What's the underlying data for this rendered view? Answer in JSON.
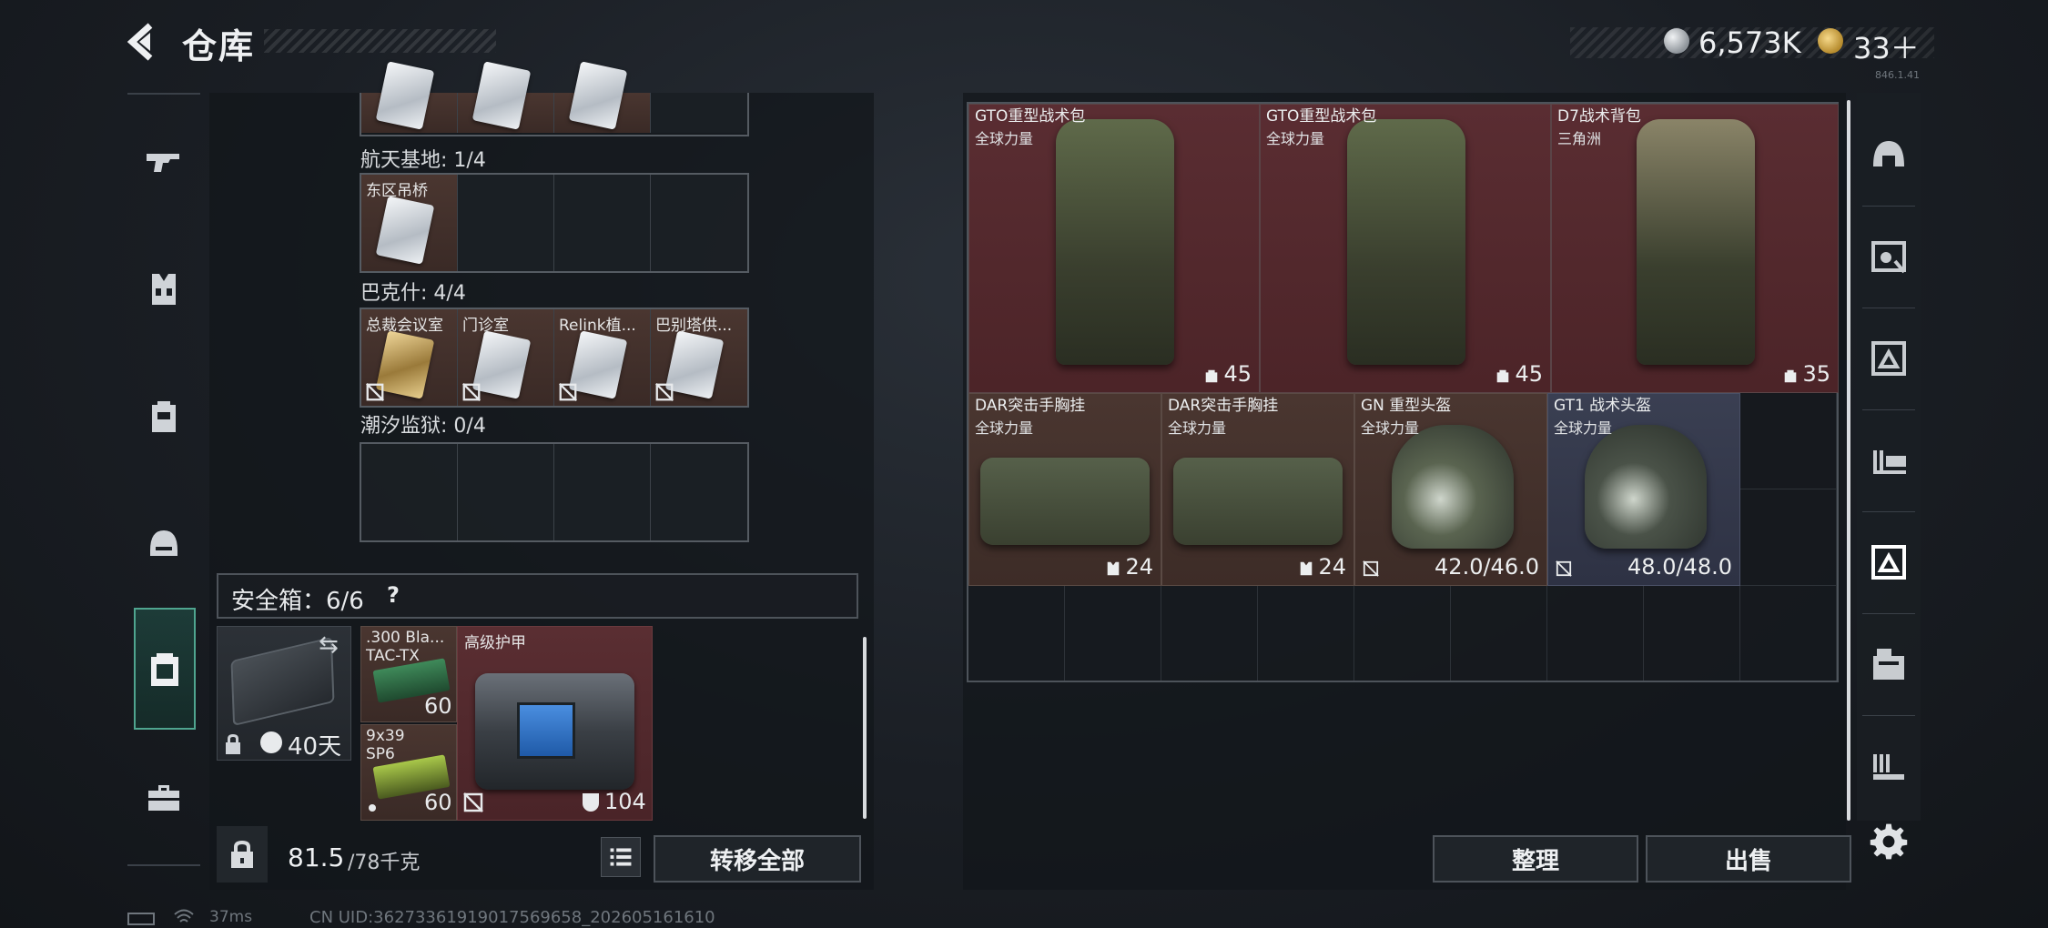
{
  "header": {
    "title": "仓库",
    "coin_value": "6,573K",
    "diamond_value": "33＋",
    "version": "846.1.41"
  },
  "left_rail": {
    "items": [
      "pistol-icon",
      "vest-icon",
      "backpack-icon",
      "helmet-icon",
      "safe-case-icon",
      "briefcase-icon"
    ],
    "active": "safe-case-icon"
  },
  "key_sections": [
    {
      "label": "航天基地: 1/4",
      "cells": [
        {
          "label": "东区吊桥",
          "card": "silver"
        },
        {
          "label": ""
        },
        {
          "label": ""
        },
        {
          "label": ""
        }
      ]
    },
    {
      "label": "巴克什: 4/4",
      "cells": [
        {
          "label": "总裁会议室",
          "card": "gold"
        },
        {
          "label": "门诊室",
          "card": "silver"
        },
        {
          "label": "Relink植...",
          "card": "silver"
        },
        {
          "label": "巴别塔供...",
          "card": "silver"
        }
      ]
    },
    {
      "label": "潮汐监狱: 0/4",
      "cells": [
        {
          "label": ""
        },
        {
          "label": ""
        },
        {
          "label": ""
        },
        {
          "label": ""
        }
      ]
    }
  ],
  "safe_box": {
    "label": "安全箱：6/6",
    "help": "?",
    "days": "40天",
    "ammo": [
      {
        "label1": ".300 Bla...",
        "label2": "TAC-TX",
        "count": "60",
        "color": "#3f8a5a"
      },
      {
        "label1": "9x39",
        "label2": "SP6",
        "count": "60",
        "color": "#a9c84a"
      }
    ],
    "armor": {
      "label": "高级护甲",
      "value": "104"
    }
  },
  "left_bottom": {
    "weight": "81.5",
    "weight_max": "/78千克",
    "transfer_all": "转移全部"
  },
  "stash_items": [
    {
      "name": "GTO重型战术包",
      "sub": "全球力量",
      "value": "45",
      "type": "backpack",
      "tone": "red",
      "tint": "#5f6a4a"
    },
    {
      "name": "GTO重型战术包",
      "sub": "全球力量",
      "value": "45",
      "type": "backpack",
      "tone": "red",
      "tint": "#5f6a4a"
    },
    {
      "name": "D7战术背包",
      "sub": "三角洲",
      "value": "35",
      "type": "backpack",
      "tone": "red",
      "tint": "#8a8468"
    },
    {
      "name": "DAR突击手胸挂",
      "sub": "全球力量",
      "value": "24",
      "type": "vest",
      "tone": "brown",
      "tint": "#56604a"
    },
    {
      "name": "DAR突击手胸挂",
      "sub": "全球力量",
      "value": "24",
      "type": "vest",
      "tone": "brown",
      "tint": "#56604a"
    },
    {
      "name": "GN 重型头盔",
      "sub": "全球力量",
      "value": "42.0/46.0",
      "type": "helmet",
      "tone": "brown",
      "tint": "#5a6450"
    },
    {
      "name": "GT1 战术头盔",
      "sub": "全球力量",
      "value": "48.0/48.0",
      "type": "helmet",
      "tone": "blue",
      "tint": "#4a5248"
    }
  ],
  "right_bottom": {
    "sort": "整理",
    "sell": "出售"
  },
  "right_rail": {
    "items": [
      "helmet-outline-icon",
      "armor-tag-icon",
      "chest-rig-icon",
      "ammo-icon",
      "rig-selected-icon",
      "container-icon",
      "ammo-belt-icon"
    ],
    "active": "rig-selected-icon"
  },
  "footer": {
    "ping": "37ms",
    "uid": "CN UID:36273361919017569658_202605161610"
  },
  "colors": {
    "accent_green": "#4fa58f",
    "item_red": "#5a2d32",
    "item_brown": "#4a3630",
    "item_blue": "#3a3f52"
  }
}
